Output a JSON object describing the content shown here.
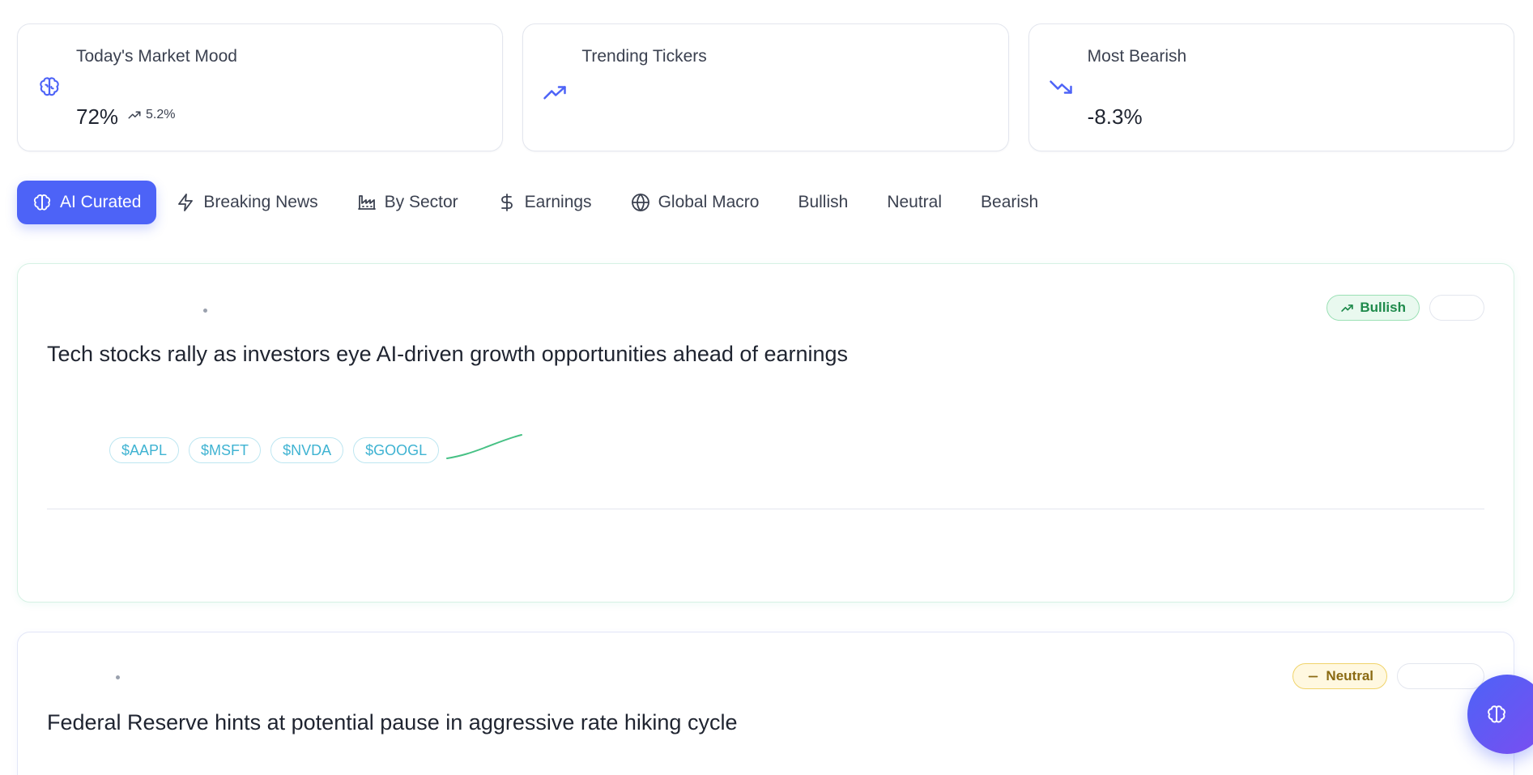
{
  "stats": [
    {
      "title": "Today's Market Mood",
      "value": "72%",
      "delta": "5.2%",
      "icon": "brain-icon"
    },
    {
      "title": "Trending Tickers",
      "value": "",
      "icon": "trending-up-icon"
    },
    {
      "title": "Most Bearish",
      "value": "-8.3%",
      "icon": "trending-down-icon"
    }
  ],
  "tabs": [
    {
      "label": "AI Curated",
      "icon": "brain-icon",
      "active": true
    },
    {
      "label": "Breaking News",
      "icon": "lightning-icon"
    },
    {
      "label": "By Sector",
      "icon": "factory-icon"
    },
    {
      "label": "Earnings",
      "icon": "dollar-icon"
    },
    {
      "label": "Global Macro",
      "icon": "globe-icon"
    },
    {
      "label": "Bullish"
    },
    {
      "label": "Neutral"
    },
    {
      "label": "Bearish"
    }
  ],
  "news": [
    {
      "headline": "Tech stocks rally as investors eye AI-driven growth opportunities ahead of earnings",
      "sentiment": "Bullish",
      "sentiment_icon": "trending-up-icon",
      "tickers": [
        "$AAPL",
        "$MSFT",
        "$NVDA",
        "$GOOGL"
      ]
    },
    {
      "headline": "Federal Reserve hints at potential pause in aggressive rate hiking cycle",
      "sentiment": "Neutral",
      "sentiment_icon": "minus-icon"
    }
  ],
  "colors": {
    "accent": "#4d63f7",
    "bullish": "#1e8a4b",
    "neutral": "#8a6a12",
    "ticker": "#3fb3d2",
    "sparkline": "#47c185"
  },
  "fab": {
    "icon": "brain-icon"
  }
}
